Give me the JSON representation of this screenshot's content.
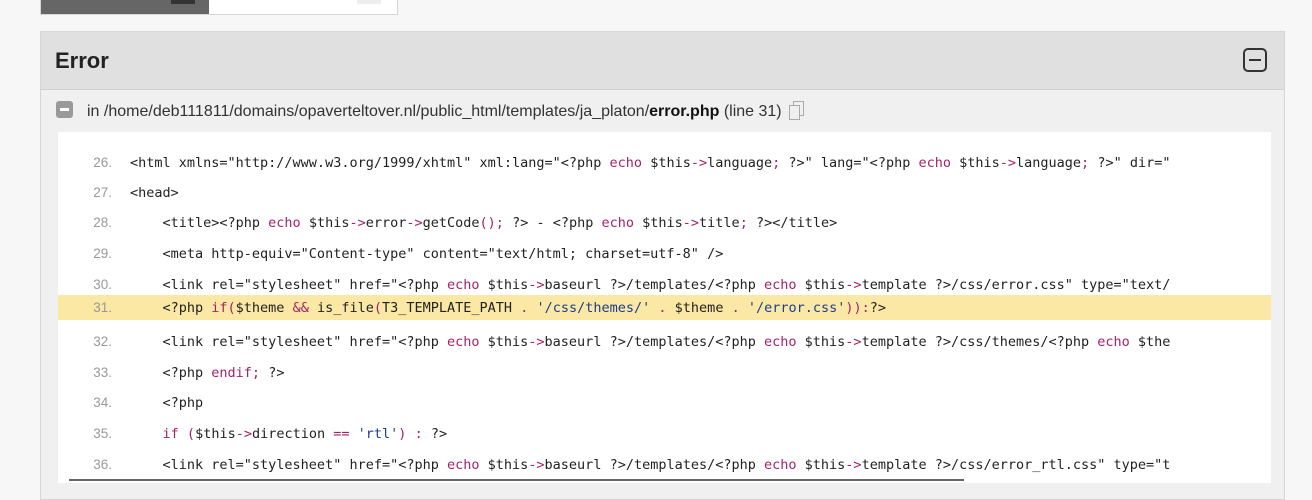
{
  "panel": {
    "title": "Error",
    "file_prefix": "in /home/deb111811/domains/opaverteltover.nl/public_html/templates/ja_platon/",
    "file_name": "error.php",
    "line_info": "(line 31)"
  },
  "code_lines": [
    {
      "num": "26.",
      "highlight": false,
      "segments": [
        {
          "t": "<html xmlns=\"http://www.w3.org/1999/xhtml\" xml:lang=\"<?php ",
          "c": ""
        },
        {
          "t": "echo",
          "c": "kw"
        },
        {
          "t": " $this",
          "c": ""
        },
        {
          "t": "->",
          "c": "kw"
        },
        {
          "t": "language",
          "c": ""
        },
        {
          "t": ";",
          "c": "kw"
        },
        {
          "t": " ?>\" lang=\"<?php ",
          "c": ""
        },
        {
          "t": "echo",
          "c": "kw"
        },
        {
          "t": " $this",
          "c": ""
        },
        {
          "t": "->",
          "c": "kw"
        },
        {
          "t": "language",
          "c": ""
        },
        {
          "t": ";",
          "c": "kw"
        },
        {
          "t": " ?>\" dir=\"",
          "c": ""
        }
      ]
    },
    {
      "num": "27.",
      "highlight": false,
      "segments": [
        {
          "t": "<head>",
          "c": ""
        }
      ]
    },
    {
      "num": "28.",
      "highlight": false,
      "segments": [
        {
          "t": "    <title><?php ",
          "c": ""
        },
        {
          "t": "echo",
          "c": "kw"
        },
        {
          "t": " $this",
          "c": ""
        },
        {
          "t": "->",
          "c": "kw"
        },
        {
          "t": "error",
          "c": ""
        },
        {
          "t": "->",
          "c": "kw"
        },
        {
          "t": "getCode",
          "c": ""
        },
        {
          "t": "();",
          "c": "kw"
        },
        {
          "t": " ?> - <?php ",
          "c": ""
        },
        {
          "t": "echo",
          "c": "kw"
        },
        {
          "t": " $this",
          "c": ""
        },
        {
          "t": "->",
          "c": "kw"
        },
        {
          "t": "title",
          "c": ""
        },
        {
          "t": ";",
          "c": "kw"
        },
        {
          "t": " ?></title>",
          "c": ""
        }
      ]
    },
    {
      "num": "29.",
      "highlight": false,
      "segments": [
        {
          "t": "    <meta http-equiv=\"Content-type\" content=\"text/html; charset=utf-8\" />",
          "c": ""
        }
      ]
    },
    {
      "num": "30.",
      "highlight": false,
      "segments": [
        {
          "t": "    <link rel=\"stylesheet\" href=\"<?php ",
          "c": ""
        },
        {
          "t": "echo",
          "c": "kw"
        },
        {
          "t": " $this",
          "c": ""
        },
        {
          "t": "->",
          "c": "kw"
        },
        {
          "t": "baseurl ?>/templates/<?php ",
          "c": ""
        },
        {
          "t": "echo",
          "c": "kw"
        },
        {
          "t": " $this",
          "c": ""
        },
        {
          "t": "->",
          "c": "kw"
        },
        {
          "t": "template ?>/css/error.css\" type=\"text/",
          "c": ""
        }
      ]
    },
    {
      "num": "31.",
      "highlight": true,
      "segments": [
        {
          "t": "    <?php ",
          "c": ""
        },
        {
          "t": "if(",
          "c": "kw"
        },
        {
          "t": "$theme ",
          "c": ""
        },
        {
          "t": "&&",
          "c": "kw"
        },
        {
          "t": " is_file",
          "c": ""
        },
        {
          "t": "(",
          "c": "kw"
        },
        {
          "t": "T3_TEMPLATE_PATH ",
          "c": ""
        },
        {
          "t": ".",
          "c": "kw"
        },
        {
          "t": " ",
          "c": ""
        },
        {
          "t": "'/css/themes/'",
          "c": "str"
        },
        {
          "t": " ",
          "c": ""
        },
        {
          "t": ".",
          "c": "kw"
        },
        {
          "t": " $theme ",
          "c": ""
        },
        {
          "t": ".",
          "c": "kw"
        },
        {
          "t": " ",
          "c": ""
        },
        {
          "t": "'/error.css'",
          "c": "str"
        },
        {
          "t": ")):",
          "c": "kw"
        },
        {
          "t": "?>",
          "c": ""
        }
      ]
    },
    {
      "num": "32.",
      "highlight": false,
      "segments": [
        {
          "t": "    <link rel=\"stylesheet\" href=\"<?php ",
          "c": ""
        },
        {
          "t": "echo",
          "c": "kw"
        },
        {
          "t": " $this",
          "c": ""
        },
        {
          "t": "->",
          "c": "kw"
        },
        {
          "t": "baseurl ?>/templates/<?php ",
          "c": ""
        },
        {
          "t": "echo",
          "c": "kw"
        },
        {
          "t": " $this",
          "c": ""
        },
        {
          "t": "->",
          "c": "kw"
        },
        {
          "t": "template ?>/css/themes/<?php ",
          "c": ""
        },
        {
          "t": "echo",
          "c": "kw"
        },
        {
          "t": " $the",
          "c": ""
        }
      ]
    },
    {
      "num": "33.",
      "highlight": false,
      "segments": [
        {
          "t": "    <?php ",
          "c": ""
        },
        {
          "t": "endif;",
          "c": "kw"
        },
        {
          "t": " ?>",
          "c": ""
        }
      ]
    },
    {
      "num": "34.",
      "highlight": false,
      "segments": [
        {
          "t": "    <?php",
          "c": ""
        }
      ]
    },
    {
      "num": "35.",
      "highlight": false,
      "segments": [
        {
          "t": "    ",
          "c": ""
        },
        {
          "t": "if",
          "c": "kw"
        },
        {
          "t": " ",
          "c": ""
        },
        {
          "t": "(",
          "c": "kw"
        },
        {
          "t": "$this",
          "c": ""
        },
        {
          "t": "->",
          "c": "kw"
        },
        {
          "t": "direction ",
          "c": ""
        },
        {
          "t": "==",
          "c": "kw"
        },
        {
          "t": " ",
          "c": ""
        },
        {
          "t": "'rtl'",
          "c": "str"
        },
        {
          "t": ")",
          "c": "kw"
        },
        {
          "t": " ",
          "c": ""
        },
        {
          "t": ":",
          "c": "kw"
        },
        {
          "t": " ?>",
          "c": ""
        }
      ]
    },
    {
      "num": "36.",
      "highlight": false,
      "segments": [
        {
          "t": "    <link rel=\"stylesheet\" href=\"<?php ",
          "c": ""
        },
        {
          "t": "echo",
          "c": "kw"
        },
        {
          "t": " $this",
          "c": ""
        },
        {
          "t": "->",
          "c": "kw"
        },
        {
          "t": "baseurl ?>/templates/<?php ",
          "c": ""
        },
        {
          "t": "echo",
          "c": "kw"
        },
        {
          "t": " $this",
          "c": ""
        },
        {
          "t": "->",
          "c": "kw"
        },
        {
          "t": "template ?>/css/error_rtl.css\" type=\"t",
          "c": ""
        }
      ]
    }
  ]
}
